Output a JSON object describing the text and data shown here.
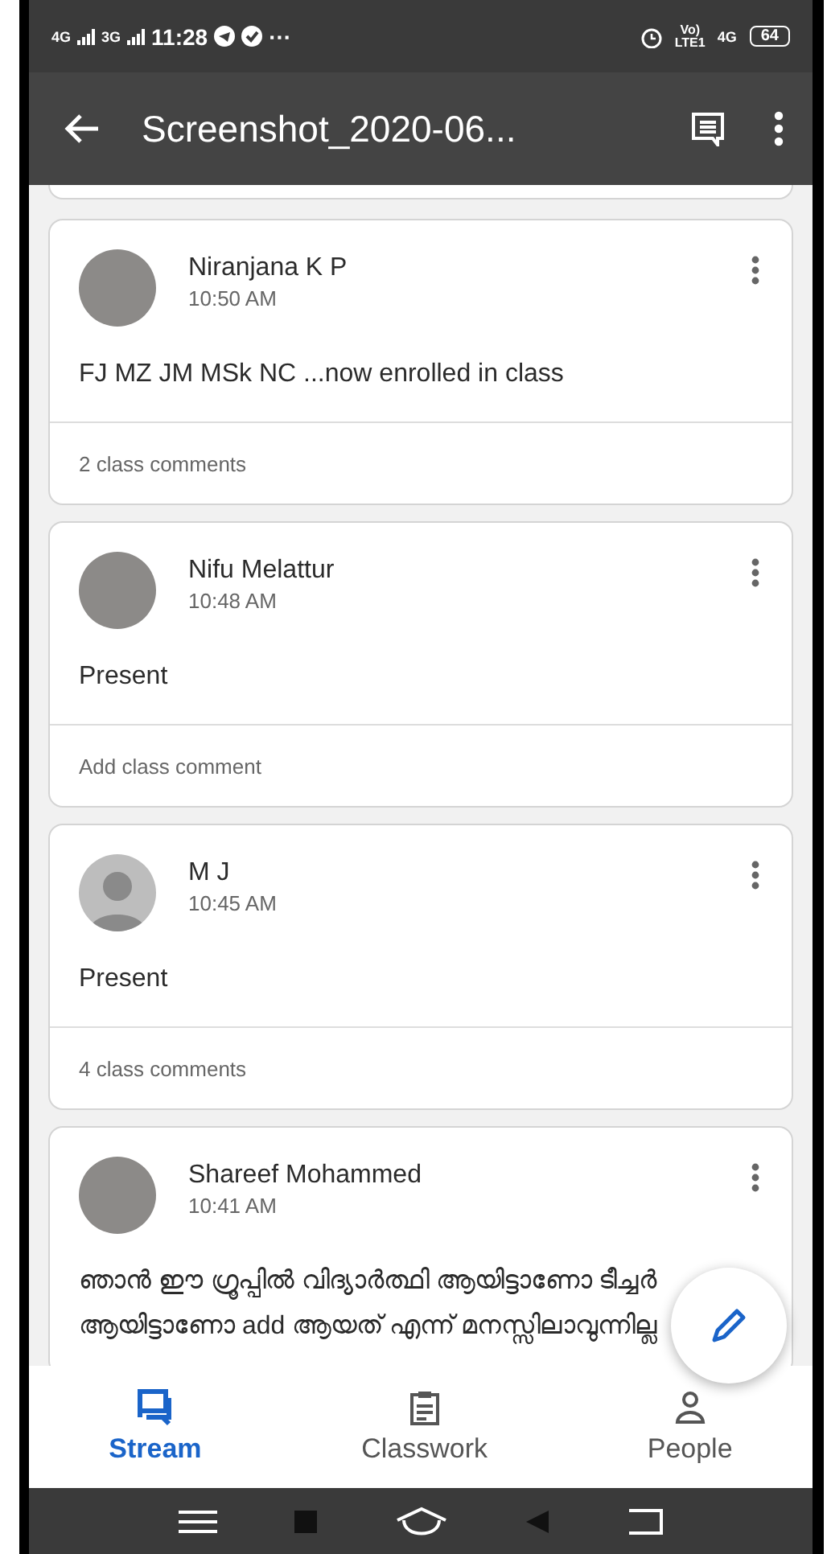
{
  "status_bar": {
    "network_1": "4G",
    "network_2": "3G",
    "time": "11:28",
    "more": "···",
    "voice": "Vo) LTE1",
    "network_3": "4G",
    "battery": "64"
  },
  "app_bar": {
    "title": "Screenshot_2020-06..."
  },
  "posts": [
    {
      "author": "Niranjana K P",
      "time": "10:50 AM",
      "kind": "photo",
      "body": "FJ MZ JM MSk NC ...now enrolled in class",
      "footer": "2 class comments"
    },
    {
      "author": "Nifu Melattur",
      "time": "10:48 AM",
      "kind": "photo",
      "body": "Present",
      "footer": "Add class comment"
    },
    {
      "author": "M J",
      "time": "10:45 AM",
      "kind": "default",
      "body": "Present",
      "footer": "4 class comments"
    },
    {
      "author": "Shareef Mohammed",
      "time": "10:41 AM",
      "kind": "photo",
      "body": "ഞാൻ ഈ ഗ്രൂപ്പിൽ വിദ്യാർത്ഥി ആയിട്ടാണോ  ടീച്ചർ ആയിട്ടാണോ add ആയത് എന്ന് മനസ്സിലാവുന്നില്ല"
    }
  ],
  "nav_tabs": [
    {
      "kind": "stream",
      "label": "Stream",
      "selected": true
    },
    {
      "kind": "classwork",
      "label": "Classwork",
      "selected": false
    },
    {
      "kind": "people",
      "label": "People",
      "selected": false
    }
  ]
}
